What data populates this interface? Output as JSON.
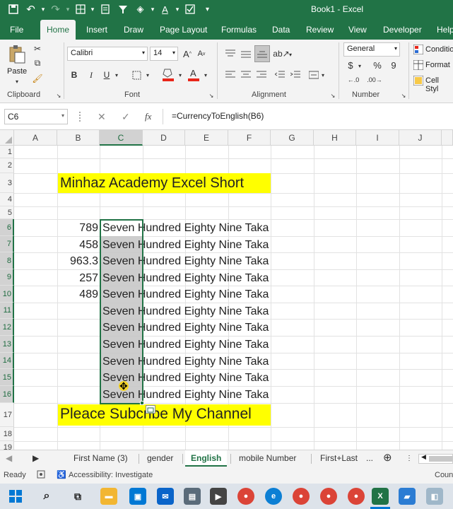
{
  "window": {
    "title": "Book1  -  Excel"
  },
  "ribbon_tabs": [
    "File",
    "Home",
    "Insert",
    "Draw",
    "Page Layout",
    "Formulas",
    "Data",
    "Review",
    "View",
    "Developer",
    "Help"
  ],
  "active_tab": "Home",
  "ribbon": {
    "clipboard": {
      "paste_label": "Paste",
      "group_label": "Clipboard"
    },
    "font": {
      "name": "Calibri",
      "size": "14",
      "bold": "B",
      "italic": "I",
      "underline": "U",
      "group_label": "Font"
    },
    "alignment": {
      "group_label": "Alignment"
    },
    "number": {
      "format": "General",
      "currency": "$",
      "percent": "%",
      "comma": "9",
      "group_label": "Number"
    },
    "styles": {
      "conditional": "Conditio",
      "format": "Format",
      "cell_styles": "Cell Styl"
    }
  },
  "formula_bar": {
    "name_box": "C6",
    "fx": "fx",
    "formula": "=CurrencyToEnglish(B6)"
  },
  "columns": [
    "A",
    "B",
    "C",
    "D",
    "E",
    "F",
    "G",
    "H",
    "I",
    "J"
  ],
  "rows": [
    "1",
    "2",
    "3",
    "4",
    "5",
    "6",
    "7",
    "8",
    "9",
    "10",
    "11",
    "12",
    "13",
    "14",
    "15",
    "16",
    "17",
    "18",
    "19"
  ],
  "cells": {
    "title": "Minhaz Academy Excel Short",
    "footer": "Pleace Subcribe My Channel",
    "b_values": [
      "789",
      "458",
      "963.3",
      "257",
      "489"
    ],
    "c_text": "Seven Hundred Eighty Nine Taka"
  },
  "sheet_tabs": [
    "First Name (3)",
    "gender",
    "English",
    "mobile Number",
    "First+Last",
    "..."
  ],
  "active_sheet": "English",
  "status": {
    "ready": "Ready",
    "accessibility": "Accessibility: Investigate",
    "count": "Coun"
  },
  "colors": {
    "accent": "#217346",
    "highlight": "#ffff00"
  }
}
